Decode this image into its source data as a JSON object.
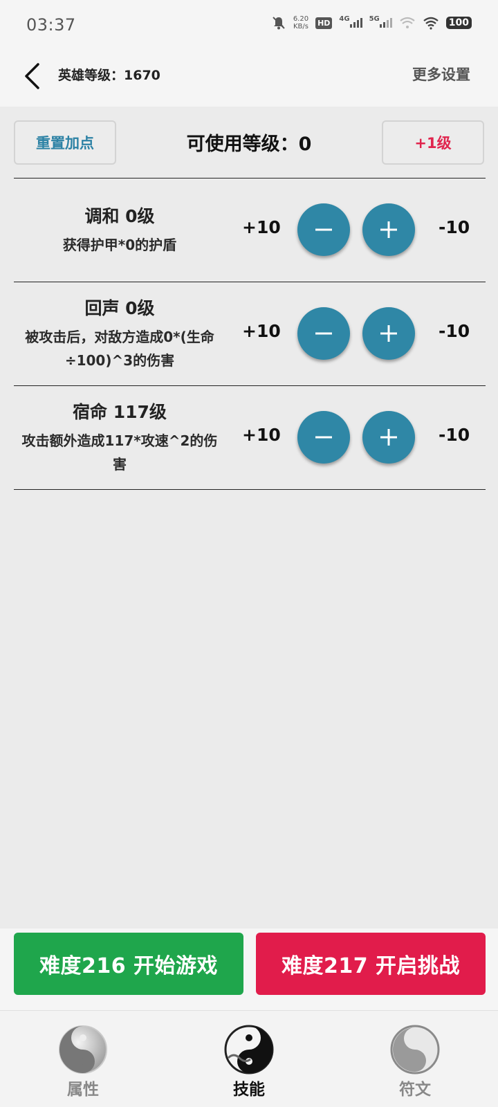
{
  "status_bar": {
    "time": "03:37",
    "net_speed_value": "6.20",
    "net_speed_unit": "KB/s",
    "hd_label": "HD",
    "sim_label": "4G",
    "sim2_label": "5G",
    "battery": "100"
  },
  "header": {
    "hero_level": "英雄等级：1670",
    "more_settings": "更多设置"
  },
  "actions": {
    "reset_label": "重置加点",
    "available_level": "可使用等级：0",
    "plus_level_label": "+1级"
  },
  "skills": [
    {
      "title": "调和  0级",
      "desc": "获得护甲*0的护盾",
      "plus": "+10",
      "minus": "-10"
    },
    {
      "title": "回声  0级",
      "desc": "被攻击后，对敌方造成0*(生命÷100)^3的伤害",
      "plus": "+10",
      "minus": "-10"
    },
    {
      "title": "宿命  117级",
      "desc": "攻击额外造成117*攻速^2的伤害",
      "plus": "+10",
      "minus": "-10"
    }
  ],
  "game_buttons": {
    "start": "难度216  开始游戏",
    "challenge": "难度217  开启挑战"
  },
  "nav": {
    "items": [
      {
        "label": "属性",
        "active": false
      },
      {
        "label": "技能",
        "active": true
      },
      {
        "label": "符文",
        "active": false
      }
    ]
  },
  "colors": {
    "accent_blue": "#2f87a6",
    "start_green": "#1fa64c",
    "challenge_red": "#e11c4b",
    "plus_level_red": "#e0244d"
  }
}
